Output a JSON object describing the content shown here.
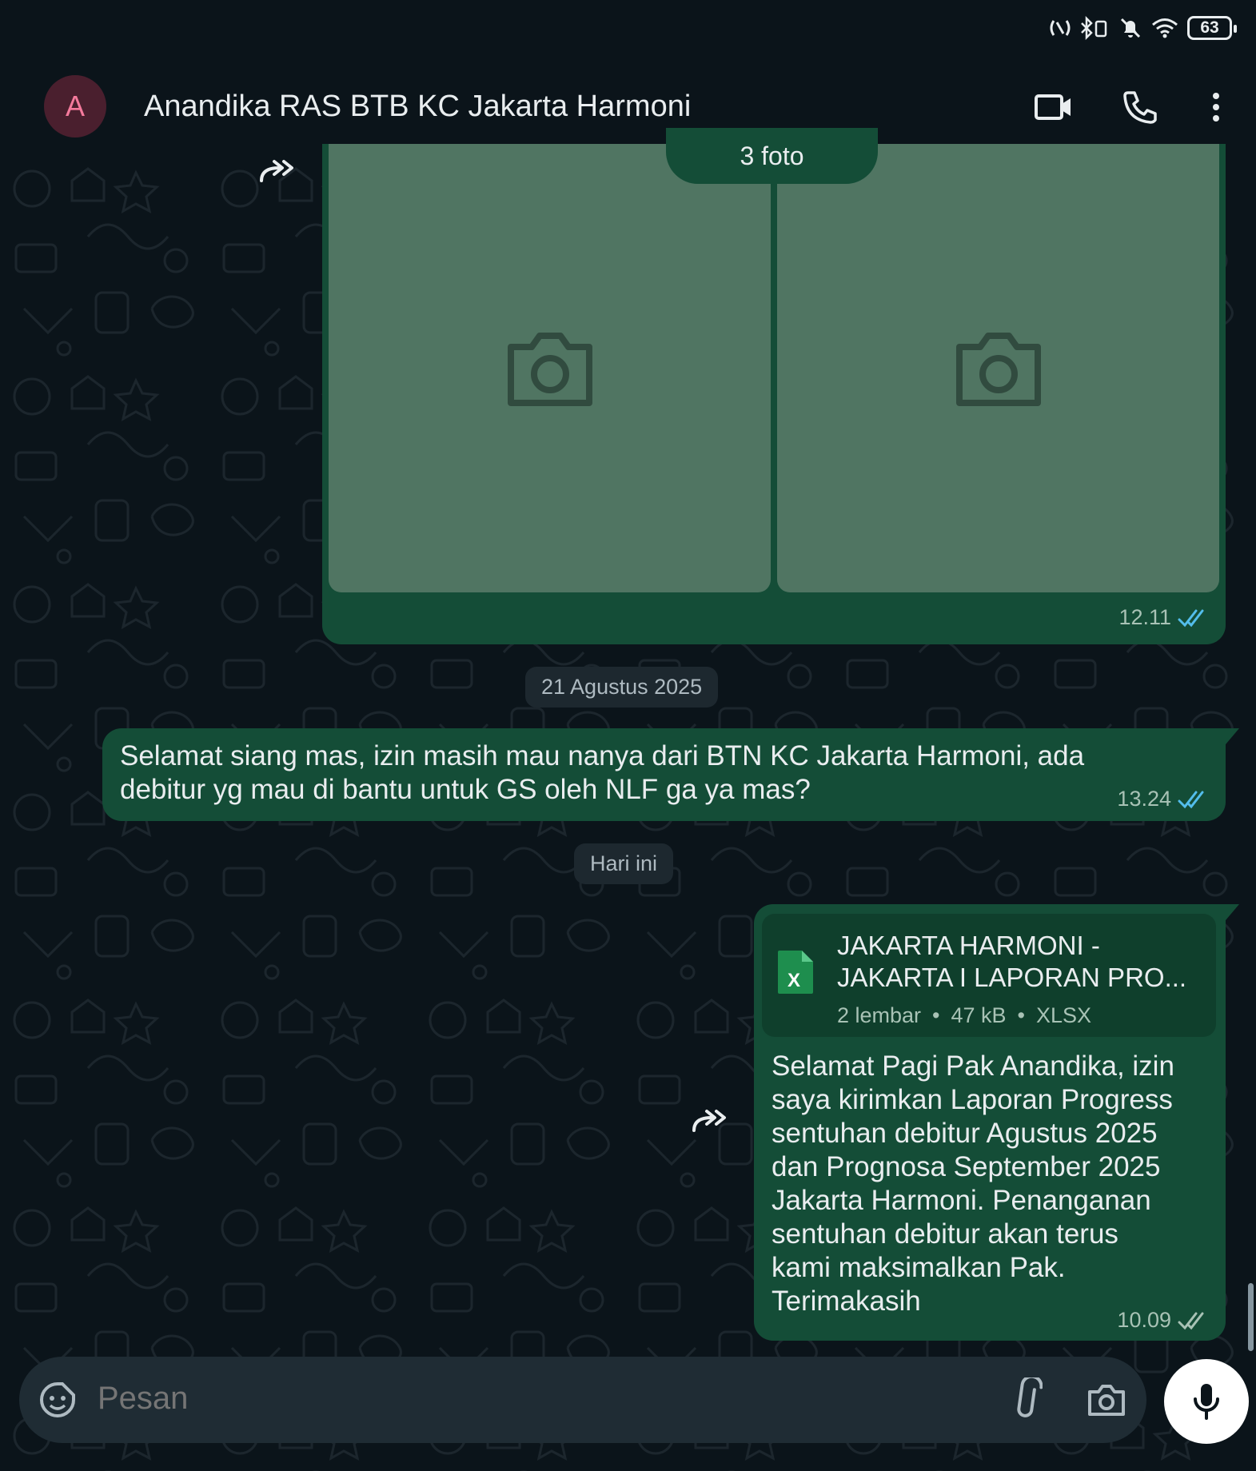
{
  "status_bar": {
    "battery": "63"
  },
  "header": {
    "avatar_letter": "A",
    "contact_name": "Anandika RAS BTB KC Jakarta Harmoni"
  },
  "messages": {
    "media": {
      "label": "3 foto",
      "time": "12.11"
    },
    "date_1": "21 Agustus 2025",
    "text_1": {
      "line1": "Selamat siang mas, izin masih mau nanya dari BTN KC Jakarta Harmoni, ada",
      "line2": "debitur yg mau di bantu untuk GS oleh NLF ga ya mas?",
      "time": "13.24"
    },
    "date_2": "Hari ini",
    "document": {
      "title_line1": "JAKARTA HARMONI -",
      "title_line2": "JAKARTA I LAPORAN PRO...",
      "pages": "2 lembar",
      "size": "47 kB",
      "type": "XLSX",
      "icon_letter": "X",
      "caption": [
        "Selamat Pagi Pak Anandika, izin",
        "saya kirimkan Laporan Progress",
        "sentuhan debitur Agustus 2025",
        "dan Prognosa September 2025",
        "Jakarta Harmoni. Penanganan",
        "sentuhan debitur akan terus",
        "kami maksimalkan Pak.",
        "Terimakasih"
      ],
      "time": "10.09"
    }
  },
  "input": {
    "placeholder": "Pesan"
  },
  "colors": {
    "bubble": "#144d37",
    "read_tick": "#53bdeb",
    "background": "#0b141a"
  }
}
